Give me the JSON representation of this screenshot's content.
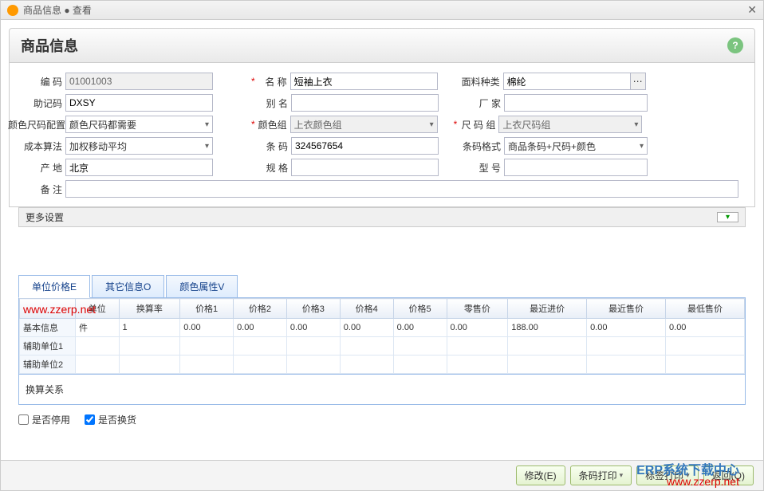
{
  "titlebar": {
    "text": "商品信息 ● 查看"
  },
  "header": {
    "title": "商品信息",
    "help": "?"
  },
  "form": {
    "code_label": "编 码",
    "code_value": "01001003",
    "mnemonic_label": "助记码",
    "mnemonic_value": "DXSY",
    "colorsize_label": "颜色尺码配置",
    "colorsize_value": "颜色尺码都需要",
    "cost_label": "成本算法",
    "cost_value": "加权移动平均",
    "origin_label": "产 地",
    "origin_value": "北京",
    "remark_label": "备 注",
    "remark_value": "",
    "name_label": "名 称",
    "name_value": "短袖上衣",
    "alias_label": "别 名",
    "alias_value": "",
    "colorgroup_label": "颜色组",
    "colorgroup_value": "上衣颜色组",
    "barcode_label": "条 码",
    "barcode_value": "324567654",
    "spec_label": "规 格",
    "spec_value": "",
    "material_label": "面料种类",
    "material_value": "棉纶",
    "factory_label": "厂  家",
    "factory_value": "",
    "sizegroup_label": "尺 码 组",
    "sizegroup_value": "上衣尺码组",
    "barcodefmt_label": "条码格式",
    "barcodefmt_value": "商品条码+尺码+颜色",
    "model_label": "型  号",
    "model_value": ""
  },
  "more_settings": "更多设置",
  "tabs": {
    "t1": "单位价格E",
    "t2": "其它信息O",
    "t3": "颜色属性V"
  },
  "table": {
    "headers": [
      "",
      "单位",
      "换算率",
      "价格1",
      "价格2",
      "价格3",
      "价格4",
      "价格5",
      "零售价",
      "最近进价",
      "最近售价",
      "最低售价"
    ],
    "rows": [
      {
        "label": "基本信息",
        "cells": [
          "件",
          "1",
          "0.00",
          "0.00",
          "0.00",
          "0.00",
          "0.00",
          "0.00",
          "188.00",
          "0.00",
          "0.00"
        ]
      },
      {
        "label": "辅助单位1",
        "cells": [
          "",
          "",
          "",
          "",
          "",
          "",
          "",
          "",
          "",
          "",
          ""
        ]
      },
      {
        "label": "辅助单位2",
        "cells": [
          "",
          "",
          "",
          "",
          "",
          "",
          "",
          "",
          "",
          "",
          ""
        ]
      }
    ]
  },
  "convert": "换算关系",
  "checks": {
    "stop": "是否停用",
    "exchange": "是否换货"
  },
  "buttons": {
    "edit": "修改(E)",
    "barcode_print": "条码打印",
    "label_print": "标签打印",
    "back": "返回(Q)"
  },
  "watermark": "www.zzerp.net",
  "watermark2": "ERP系统下载中心",
  "watermark3": "www.zzerp.net"
}
